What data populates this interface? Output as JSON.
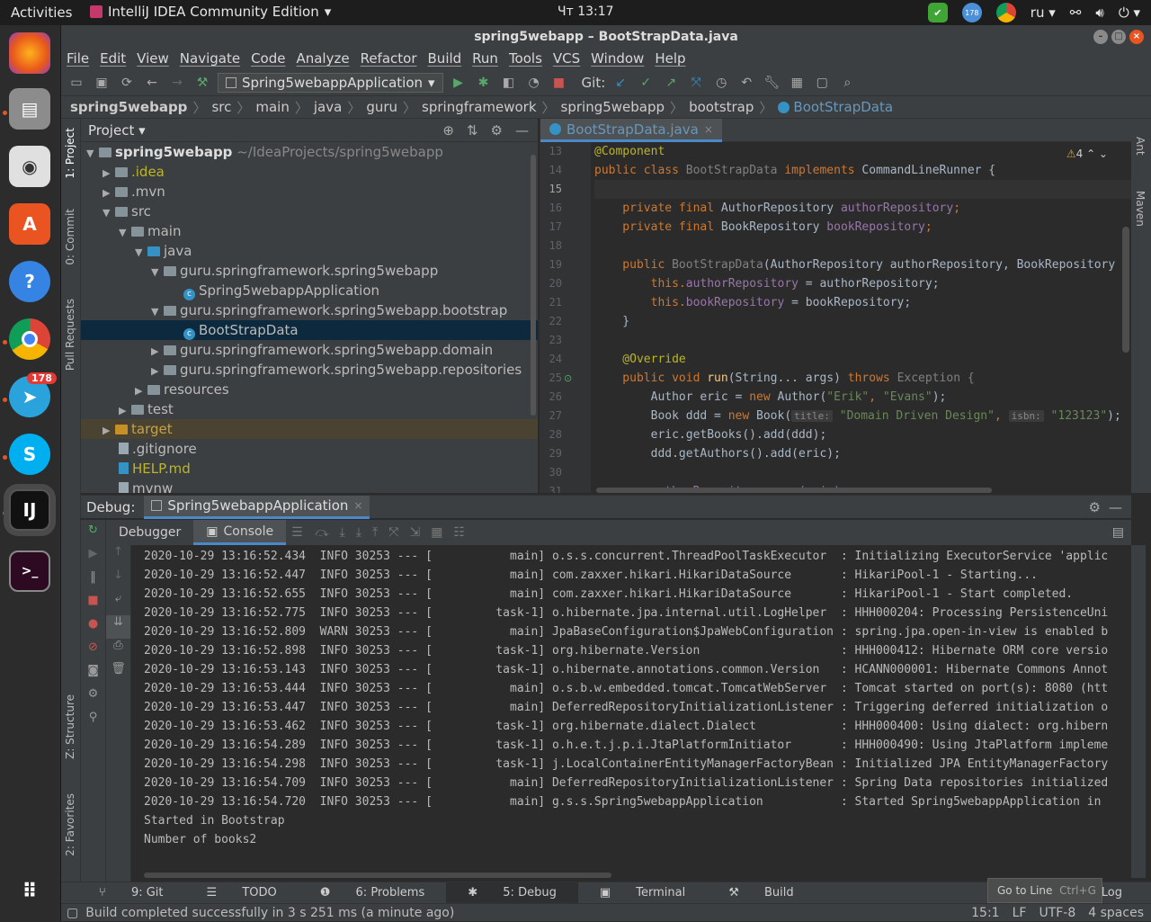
{
  "desktop": {
    "activities": "Activities",
    "app_menu": "IntelliJ IDEA Community Edition",
    "clock": "Чт 13:17",
    "language": "ru",
    "badge_tray": "178",
    "badge_telegram": "178"
  },
  "window": {
    "title": "spring5webapp – BootStrapData.java"
  },
  "menu": [
    "File",
    "Edit",
    "View",
    "Navigate",
    "Code",
    "Analyze",
    "Refactor",
    "Build",
    "Run",
    "Tools",
    "VCS",
    "Window",
    "Help"
  ],
  "toolbar": {
    "run_config": "Spring5webappApplication",
    "git_label": "Git:"
  },
  "breadcrumbs": [
    "spring5webapp",
    "src",
    "main",
    "java",
    "guru",
    "springframework",
    "spring5webapp",
    "bootstrap",
    "BootStrapData"
  ],
  "left_strip": {
    "project": "1: Project",
    "commit": "0: Commit",
    "pull": "Pull Requests",
    "structure": "Z: Structure",
    "favorites": "2: Favorites"
  },
  "right_strip": {
    "ant": "Ant",
    "maven": "Maven"
  },
  "project": {
    "header": "Project",
    "root_name": "spring5webapp",
    "root_path": "~/IdeaProjects/spring5webapp",
    "items": [
      {
        "label": ".idea"
      },
      {
        "label": ".mvn"
      },
      {
        "label": "src"
      },
      {
        "label": "main"
      },
      {
        "label": "java"
      },
      {
        "label": "guru.springframework.spring5webapp"
      },
      {
        "label": "Spring5webappApplication"
      },
      {
        "label": "guru.springframework.spring5webapp.bootstrap"
      },
      {
        "label": "BootStrapData"
      },
      {
        "label": "guru.springframework.spring5webapp.domain"
      },
      {
        "label": "guru.springframework.spring5webapp.repositories"
      },
      {
        "label": "resources"
      },
      {
        "label": "test"
      },
      {
        "label": "target"
      },
      {
        "label": ".gitignore"
      },
      {
        "label": "HELP.md"
      },
      {
        "label": "mvnw"
      }
    ]
  },
  "editor": {
    "tab": "BootStrapData.java",
    "warnings": "4",
    "line_numbers": [
      "13",
      "14",
      "15",
      "16",
      "17",
      "18",
      "19",
      "20",
      "21",
      "22",
      "23",
      "24",
      "25",
      "26",
      "27",
      "28",
      "29",
      "30",
      "31"
    ],
    "code": {
      "l13": "@Component",
      "l14a": "public class ",
      "l14b": "BootStrapData ",
      "l14c": "implements ",
      "l14d": "CommandLineRunner {",
      "l16a": "    private final ",
      "l16b": "AuthorRepository ",
      "l16c": "authorRepository",
      "l17a": "    private final ",
      "l17b": "BookRepository ",
      "l17c": "bookRepository",
      "l19a": "    public ",
      "l19b": "BootStrapData",
      "l19c": "(AuthorRepository authorRepository, BookRepository",
      "l20a": "        this.",
      "l20b": "authorRepository",
      " l20c": " = authorRepository;",
      "l21a": "        this.",
      "l21b": "bookRepository",
      "l21c": " = bookRepository;",
      "l22": "    }",
      "l24": "    @Override",
      "l25a": "    public void ",
      "l25b": "run",
      "l25c": "(String... args) ",
      "l25d": "throws ",
      "l25e": "Exception {",
      "l26a": "        Author eric = ",
      "l26b": "new ",
      "l26c": "Author(",
      "l26d": "\"Erik\"",
      ", ": ", ",
      "l26e": "\"Evans\"",
      "l26f": ");",
      "l27a": "        Book ddd = ",
      "l27b": "new ",
      "l27c": "Book(",
      "l27h1": "title:",
      "l27d": "\"Domain Driven Design\"",
      "l27h2": "isbn:",
      "l27e": "\"123123\"",
      "l27f": ");",
      "l28": "        eric.getBooks().add(ddd);",
      "l29": "        ddd.getAuthors().add(eric);",
      "l31": "        authorRepository.save(eric);"
    }
  },
  "debug": {
    "label": "Debug:",
    "config": "Spring5webappApplication",
    "tab_debugger": "Debugger",
    "tab_console": "Console"
  },
  "console": [
    "2020-10-29 13:16:52.434  INFO 30253 --- [           main] o.s.s.concurrent.ThreadPoolTaskExecutor  : Initializing ExecutorService 'applic",
    "2020-10-29 13:16:52.447  INFO 30253 --- [           main] com.zaxxer.hikari.HikariDataSource       : HikariPool-1 - Starting...",
    "2020-10-29 13:16:52.655  INFO 30253 --- [           main] com.zaxxer.hikari.HikariDataSource       : HikariPool-1 - Start completed.",
    "2020-10-29 13:16:52.775  INFO 30253 --- [         task-1] o.hibernate.jpa.internal.util.LogHelper  : HHH000204: Processing PersistenceUni",
    "2020-10-29 13:16:52.809  WARN 30253 --- [           main] JpaBaseConfiguration$JpaWebConfiguration : spring.jpa.open-in-view is enabled b",
    "2020-10-29 13:16:52.898  INFO 30253 --- [         task-1] org.hibernate.Version                    : HHH000412: Hibernate ORM core versio",
    "2020-10-29 13:16:53.143  INFO 30253 --- [         task-1] o.hibernate.annotations.common.Version   : HCANN000001: Hibernate Commons Annot",
    "2020-10-29 13:16:53.444  INFO 30253 --- [           main] o.s.b.w.embedded.tomcat.TomcatWebServer  : Tomcat started on port(s): 8080 (htt",
    "2020-10-29 13:16:53.447  INFO 30253 --- [           main] DeferredRepositoryInitializationListener : Triggering deferred initialization o",
    "2020-10-29 13:16:53.462  INFO 30253 --- [         task-1] org.hibernate.dialect.Dialect            : HHH000400: Using dialect: org.hibern",
    "2020-10-29 13:16:54.289  INFO 30253 --- [         task-1] o.h.e.t.j.p.i.JtaPlatformInitiator       : HHH000490: Using JtaPlatform impleme",
    "2020-10-29 13:16:54.298  INFO 30253 --- [         task-1] j.LocalContainerEntityManagerFactoryBean : Initialized JPA EntityManagerFactory",
    "2020-10-29 13:16:54.709  INFO 30253 --- [           main] DeferredRepositoryInitializationListener : Spring Data repositories initialized",
    "2020-10-29 13:16:54.720  INFO 30253 --- [           main] g.s.s.Spring5webappApplication           : Started Spring5webappApplication in",
    "Started in Bootstrap",
    "Number of books2"
  ],
  "bottom_tabs": [
    "9: Git",
    "TODO",
    "6: Problems",
    "5: Debug",
    "Terminal",
    "Build",
    "Log"
  ],
  "tooltip": {
    "text": "Go to Line",
    "shortcut": "Ctrl+G"
  },
  "status": {
    "message": "Build completed successfully in 3 s 251 ms (a minute ago)",
    "position": "15:1",
    "line_sep": "LF",
    "encoding": "UTF-8",
    "indent": "4 spaces"
  }
}
